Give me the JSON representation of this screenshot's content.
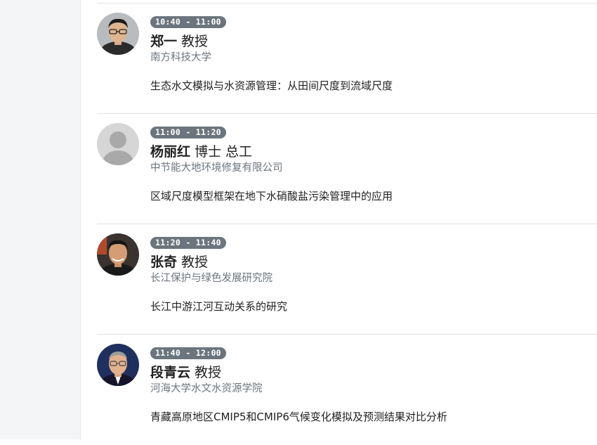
{
  "colors": {
    "badge_bg": "#6c757d",
    "affiliation_text": "#6c757d",
    "divider": "#e2e2e2",
    "sidebar_bg": "#f4f5f7"
  },
  "schedule": [
    {
      "time": "10:40 - 11:00",
      "name": "郑一",
      "title": "教授",
      "affiliation": "南方科技大学",
      "talk": "生态水文模拟与水资源管理：从田间尺度到流域尺度",
      "avatar": "speaker-photo"
    },
    {
      "time": "11:00 - 11:20",
      "name": "杨丽红",
      "title": "博士 总工",
      "affiliation": "中节能大地环境修复有限公司",
      "talk": "区域尺度模型框架在地下水硝酸盐污染管理中的应用",
      "avatar": "default-avatar"
    },
    {
      "time": "11:20 - 11:40",
      "name": "张奇",
      "title": "教授",
      "affiliation": "长江保护与绿色发展研究院",
      "talk": "长江中游江河互动关系的研究",
      "avatar": "speaker-photo"
    },
    {
      "time": "11:40 - 12:00",
      "name": "段青云",
      "title": "教授",
      "affiliation": "河海大学水文水资源学院",
      "talk": "青藏高原地区CMIP5和CMIP6气候变化模拟及预测结果对比分析",
      "avatar": "speaker-photo"
    }
  ]
}
